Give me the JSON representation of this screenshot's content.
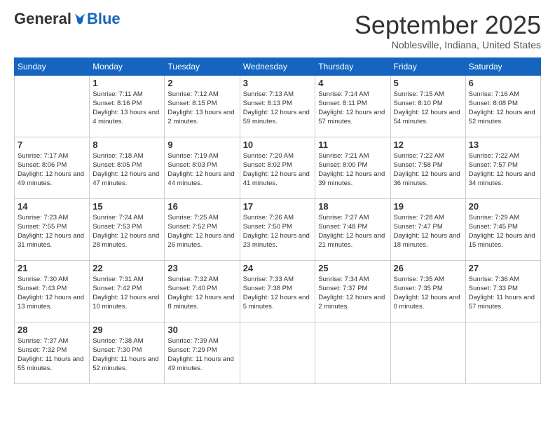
{
  "logo": {
    "general": "General",
    "blue": "Blue"
  },
  "title": "September 2025",
  "location": "Noblesville, Indiana, United States",
  "days_header": [
    "Sunday",
    "Monday",
    "Tuesday",
    "Wednesday",
    "Thursday",
    "Friday",
    "Saturday"
  ],
  "weeks": [
    [
      {
        "day": "",
        "sunrise": "",
        "sunset": "",
        "daylight": ""
      },
      {
        "day": "1",
        "sunrise": "Sunrise: 7:11 AM",
        "sunset": "Sunset: 8:16 PM",
        "daylight": "Daylight: 13 hours and 4 minutes."
      },
      {
        "day": "2",
        "sunrise": "Sunrise: 7:12 AM",
        "sunset": "Sunset: 8:15 PM",
        "daylight": "Daylight: 13 hours and 2 minutes."
      },
      {
        "day": "3",
        "sunrise": "Sunrise: 7:13 AM",
        "sunset": "Sunset: 8:13 PM",
        "daylight": "Daylight: 12 hours and 59 minutes."
      },
      {
        "day": "4",
        "sunrise": "Sunrise: 7:14 AM",
        "sunset": "Sunset: 8:11 PM",
        "daylight": "Daylight: 12 hours and 57 minutes."
      },
      {
        "day": "5",
        "sunrise": "Sunrise: 7:15 AM",
        "sunset": "Sunset: 8:10 PM",
        "daylight": "Daylight: 12 hours and 54 minutes."
      },
      {
        "day": "6",
        "sunrise": "Sunrise: 7:16 AM",
        "sunset": "Sunset: 8:08 PM",
        "daylight": "Daylight: 12 hours and 52 minutes."
      }
    ],
    [
      {
        "day": "7",
        "sunrise": "Sunrise: 7:17 AM",
        "sunset": "Sunset: 8:06 PM",
        "daylight": "Daylight: 12 hours and 49 minutes."
      },
      {
        "day": "8",
        "sunrise": "Sunrise: 7:18 AM",
        "sunset": "Sunset: 8:05 PM",
        "daylight": "Daylight: 12 hours and 47 minutes."
      },
      {
        "day": "9",
        "sunrise": "Sunrise: 7:19 AM",
        "sunset": "Sunset: 8:03 PM",
        "daylight": "Daylight: 12 hours and 44 minutes."
      },
      {
        "day": "10",
        "sunrise": "Sunrise: 7:20 AM",
        "sunset": "Sunset: 8:02 PM",
        "daylight": "Daylight: 12 hours and 41 minutes."
      },
      {
        "day": "11",
        "sunrise": "Sunrise: 7:21 AM",
        "sunset": "Sunset: 8:00 PM",
        "daylight": "Daylight: 12 hours and 39 minutes."
      },
      {
        "day": "12",
        "sunrise": "Sunrise: 7:22 AM",
        "sunset": "Sunset: 7:58 PM",
        "daylight": "Daylight: 12 hours and 36 minutes."
      },
      {
        "day": "13",
        "sunrise": "Sunrise: 7:22 AM",
        "sunset": "Sunset: 7:57 PM",
        "daylight": "Daylight: 12 hours and 34 minutes."
      }
    ],
    [
      {
        "day": "14",
        "sunrise": "Sunrise: 7:23 AM",
        "sunset": "Sunset: 7:55 PM",
        "daylight": "Daylight: 12 hours and 31 minutes."
      },
      {
        "day": "15",
        "sunrise": "Sunrise: 7:24 AM",
        "sunset": "Sunset: 7:53 PM",
        "daylight": "Daylight: 12 hours and 28 minutes."
      },
      {
        "day": "16",
        "sunrise": "Sunrise: 7:25 AM",
        "sunset": "Sunset: 7:52 PM",
        "daylight": "Daylight: 12 hours and 26 minutes."
      },
      {
        "day": "17",
        "sunrise": "Sunrise: 7:26 AM",
        "sunset": "Sunset: 7:50 PM",
        "daylight": "Daylight: 12 hours and 23 minutes."
      },
      {
        "day": "18",
        "sunrise": "Sunrise: 7:27 AM",
        "sunset": "Sunset: 7:48 PM",
        "daylight": "Daylight: 12 hours and 21 minutes."
      },
      {
        "day": "19",
        "sunrise": "Sunrise: 7:28 AM",
        "sunset": "Sunset: 7:47 PM",
        "daylight": "Daylight: 12 hours and 18 minutes."
      },
      {
        "day": "20",
        "sunrise": "Sunrise: 7:29 AM",
        "sunset": "Sunset: 7:45 PM",
        "daylight": "Daylight: 12 hours and 15 minutes."
      }
    ],
    [
      {
        "day": "21",
        "sunrise": "Sunrise: 7:30 AM",
        "sunset": "Sunset: 7:43 PM",
        "daylight": "Daylight: 12 hours and 13 minutes."
      },
      {
        "day": "22",
        "sunrise": "Sunrise: 7:31 AM",
        "sunset": "Sunset: 7:42 PM",
        "daylight": "Daylight: 12 hours and 10 minutes."
      },
      {
        "day": "23",
        "sunrise": "Sunrise: 7:32 AM",
        "sunset": "Sunset: 7:40 PM",
        "daylight": "Daylight: 12 hours and 8 minutes."
      },
      {
        "day": "24",
        "sunrise": "Sunrise: 7:33 AM",
        "sunset": "Sunset: 7:38 PM",
        "daylight": "Daylight: 12 hours and 5 minutes."
      },
      {
        "day": "25",
        "sunrise": "Sunrise: 7:34 AM",
        "sunset": "Sunset: 7:37 PM",
        "daylight": "Daylight: 12 hours and 2 minutes."
      },
      {
        "day": "26",
        "sunrise": "Sunrise: 7:35 AM",
        "sunset": "Sunset: 7:35 PM",
        "daylight": "Daylight: 12 hours and 0 minutes."
      },
      {
        "day": "27",
        "sunrise": "Sunrise: 7:36 AM",
        "sunset": "Sunset: 7:33 PM",
        "daylight": "Daylight: 11 hours and 57 minutes."
      }
    ],
    [
      {
        "day": "28",
        "sunrise": "Sunrise: 7:37 AM",
        "sunset": "Sunset: 7:32 PM",
        "daylight": "Daylight: 11 hours and 55 minutes."
      },
      {
        "day": "29",
        "sunrise": "Sunrise: 7:38 AM",
        "sunset": "Sunset: 7:30 PM",
        "daylight": "Daylight: 11 hours and 52 minutes."
      },
      {
        "day": "30",
        "sunrise": "Sunrise: 7:39 AM",
        "sunset": "Sunset: 7:29 PM",
        "daylight": "Daylight: 11 hours and 49 minutes."
      },
      {
        "day": "",
        "sunrise": "",
        "sunset": "",
        "daylight": ""
      },
      {
        "day": "",
        "sunrise": "",
        "sunset": "",
        "daylight": ""
      },
      {
        "day": "",
        "sunrise": "",
        "sunset": "",
        "daylight": ""
      },
      {
        "day": "",
        "sunrise": "",
        "sunset": "",
        "daylight": ""
      }
    ]
  ]
}
